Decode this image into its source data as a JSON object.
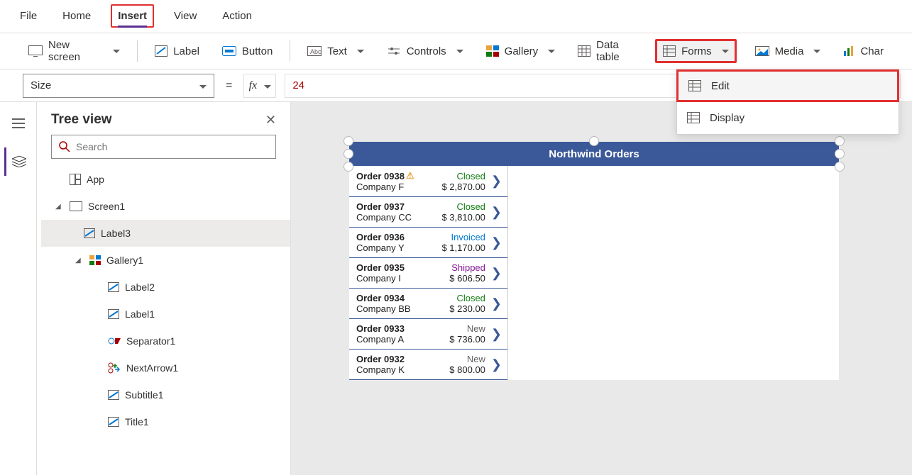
{
  "menubar": {
    "items": [
      "File",
      "Home",
      "Insert",
      "View",
      "Action"
    ],
    "active_index": 2
  },
  "ribbon": {
    "new_screen": "New screen",
    "label": "Label",
    "button": "Button",
    "text": "Text",
    "controls": "Controls",
    "gallery": "Gallery",
    "data_table": "Data table",
    "forms": "Forms",
    "media": "Media",
    "chart": "Char"
  },
  "forms_menu": {
    "edit": "Edit",
    "display": "Display"
  },
  "formula": {
    "property": "Size",
    "value": "24"
  },
  "tree_panel": {
    "title": "Tree view",
    "search_placeholder": "Search",
    "app": "App",
    "screen1": "Screen1",
    "label3": "Label3",
    "gallery1": "Gallery1",
    "label2": "Label2",
    "label1": "Label1",
    "separator1": "Separator1",
    "nextarrow1": "NextArrow1",
    "subtitle1": "Subtitle1",
    "title1": "Title1"
  },
  "canvas": {
    "app_title": "Northwind Orders",
    "orders": [
      {
        "order": "Order 0938",
        "company": "Company F",
        "status": "Closed",
        "status_class": "closed",
        "amount": "$ 2,870.00",
        "warn": true
      },
      {
        "order": "Order 0937",
        "company": "Company CC",
        "status": "Closed",
        "status_class": "closed",
        "amount": "$ 3,810.00",
        "warn": false
      },
      {
        "order": "Order 0936",
        "company": "Company Y",
        "status": "Invoiced",
        "status_class": "invoiced",
        "amount": "$ 1,170.00",
        "warn": false
      },
      {
        "order": "Order 0935",
        "company": "Company I",
        "status": "Shipped",
        "status_class": "shipped",
        "amount": "$ 606.50",
        "warn": false
      },
      {
        "order": "Order 0934",
        "company": "Company BB",
        "status": "Closed",
        "status_class": "closed",
        "amount": "$ 230.00",
        "warn": false
      },
      {
        "order": "Order 0933",
        "company": "Company A",
        "status": "New",
        "status_class": "new",
        "amount": "$ 736.00",
        "warn": false
      },
      {
        "order": "Order 0932",
        "company": "Company K",
        "status": "New",
        "status_class": "new",
        "amount": "$ 800.00",
        "warn": false
      }
    ]
  }
}
